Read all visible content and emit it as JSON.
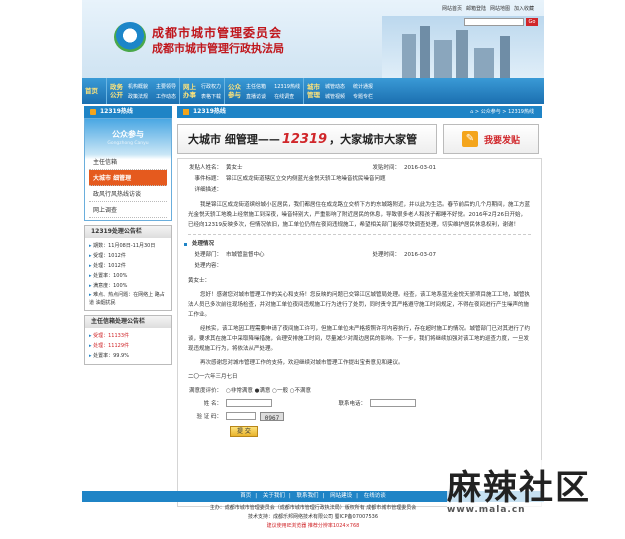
{
  "header": {
    "title_main": "成都市城市管理委员会",
    "title_sub": "成都市城市管理行政执法局",
    "top_links": [
      "网站首页",
      "邮箱登陆",
      "网站地图",
      "加入收藏"
    ],
    "go_label": "Go"
  },
  "nav": [
    {
      "title": "首页",
      "links": []
    },
    {
      "title": "政务公开",
      "links": [
        "机构概貌",
        "主要领导",
        "政策法规",
        "工作动态"
      ]
    },
    {
      "title": "网上办事",
      "links": [
        "行政权力",
        "表格下载"
      ]
    },
    {
      "title": "公众参与",
      "links": [
        "主任信箱",
        "12319热线",
        "直播访谈",
        "在线调查"
      ]
    },
    {
      "title": "城市管理",
      "links": [
        "城管动态",
        "统计通报",
        "城管视频",
        "专题专栏"
      ]
    }
  ],
  "sidebar": {
    "section_title": "12319热线",
    "public": {
      "title": "公众参与",
      "subtitle": "Gongzhong Canyu",
      "items": [
        "主任信箱",
        "大城市 细管理",
        "政风行风热线访谈",
        "网上调查"
      ],
      "active_index": 1
    },
    "announce1": {
      "title": "12319处理公告栏",
      "lines": [
        "期数：11月08日-11月30日",
        "受理：1012件",
        "处理：1012件",
        "处置率：100%",
        "满意度：100%",
        "难点、热点问题：在网络上 路占道 油烟扰民"
      ]
    },
    "announce2": {
      "title": "主任信箱处理公告栏",
      "lines": [
        "受理：11133件",
        "处理：11129件",
        "处置率：99.9%"
      ],
      "red_values": [
        "11133",
        "11129"
      ]
    }
  },
  "main": {
    "section_title": "12319热线",
    "breadcrumb": "⌂ > 公众参与 > 12319热线",
    "banner_left_pre": "大城市 细管理——",
    "banner_number": "12319",
    "banner_left_post": "，大家城市大家管",
    "banner_right": "我要发贴",
    "sender_label": "发贴人姓名：",
    "sender": "黄女士",
    "sent_time_label": "发贴时间：",
    "sent_time": "2016-03-01",
    "event_label": "事件标题：",
    "event_title": "锦江区成龙街道辖区立交内侧蓝光金悦天骄工地噪音扰民噪音问题",
    "desc_label": "详细描述：",
    "desc": "我是锦江区成龙街道缤纷城小区居民，我们都居住在成龙路立交桥下方的东城路附近，并以此为生活。春节前后的几个月期间，施工方蓝光金悦天骄工地晚上经常施工到深夜，噪音特别大，严重影响了附近居民的休息，导致很多老人和孩子都睡不好觉。2016年2月26日开始，已经向12319反映多次，但情况依旧，施工单位仍然在夜间违规施工，希望相关部门能够尽快调查处理，切实维护居民休息权利，谢谢！",
    "handle_title": "处理情况",
    "dept_label": "处理部门：",
    "dept": "市城管监督中心",
    "resp_time_label": "处理时间：",
    "resp_time": "2016-03-07",
    "content_label": "处理内容：",
    "reply": [
      "黄女士：",
      "您好！感谢您对城市管理工作的关心和支持！您反映的问题已交锦江区城管局处理。经查，该工地系蓝光金悦天骄项目施工工地，城管执法人员已多次前往现场检查，并对施工单位夜间违规施工行为进行了处罚，同时责令其严格遵守施工时间规定，不得在夜间进行产生噪声的施工作业。",
      "经核实，该工地因工程需要申请了夜间施工许可，但施工单位未严格按照许可内容执行，存在超时施工的情况。城管部门已对其进行了约谈，要求其在施工中采取降噪措施，合理安排施工时间，尽量减少对周边居民的影响。下一步，我们将继续加强对该工地的巡查力度，一旦发现违规施工行为，将依法从严处理。",
      "再次感谢您对城市管理工作的支持，欢迎继续对城市管理工作提出宝贵意见和建议。",
      "二〇一六年三月七日"
    ],
    "rating_label": "满意度评价：",
    "ratings": [
      "非常满意",
      "满意",
      "一般",
      "不满意"
    ],
    "name_label": "姓  名：",
    "phone_label": "联系电话：",
    "captcha_label": "验 证 码：",
    "captcha_value": "0967",
    "submit_label": "提 交"
  },
  "footer": {
    "links": [
      "首页",
      "关于我们",
      "联系我们",
      "网站建设",
      "在线访谈"
    ],
    "line1": "主办：成都市城市管理委员会（成都市城市管理行政执法局）版权所有  成都市城市管理委员会",
    "line2": "技术支持：成都乐邦网络技术有限公司  蜀ICP备07007536",
    "line3": "建议使用IE浏览器  推荐分辨率1024×768"
  },
  "watermark": {
    "text": "麻辣社区",
    "url": "www.mala.cn"
  }
}
